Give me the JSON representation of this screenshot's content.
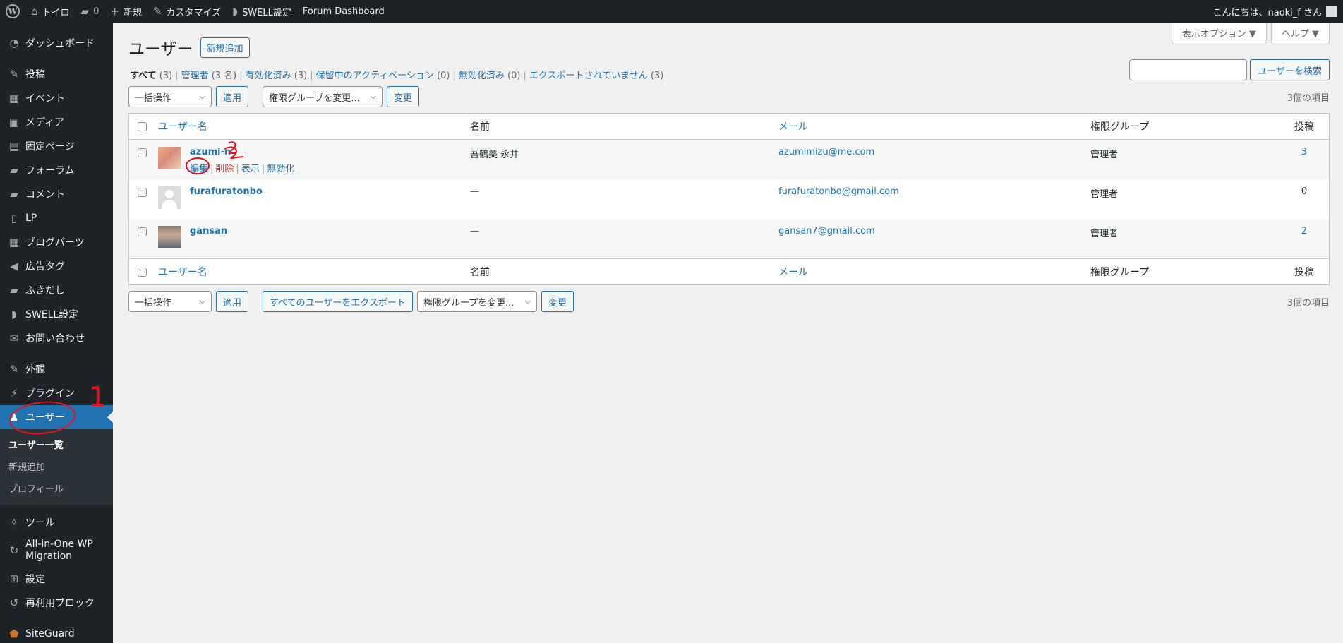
{
  "adminbar": {
    "site_name": "トイロ",
    "comments_count": "0",
    "new_label": "新規",
    "customize_label": "カスタマイズ",
    "swell_label": "SWELL設定",
    "forum_label": "Forum Dashboard",
    "greeting": "こんにちは、naoki_f さん"
  },
  "sidebar": {
    "items": [
      {
        "label": "ダッシュボード"
      },
      {
        "label": "投稿"
      },
      {
        "label": "イベント"
      },
      {
        "label": "メディア"
      },
      {
        "label": "固定ページ"
      },
      {
        "label": "フォーラム"
      },
      {
        "label": "コメント"
      },
      {
        "label": "LP"
      },
      {
        "label": "ブログパーツ"
      },
      {
        "label": "広告タグ"
      },
      {
        "label": "ふきだし"
      },
      {
        "label": "SWELL設定"
      },
      {
        "label": "お問い合わせ"
      },
      {
        "label": "外観"
      },
      {
        "label": "プラグイン"
      },
      {
        "label": "ユーザー"
      },
      {
        "label": "ツール"
      },
      {
        "label": "All-in-One WP Migration"
      },
      {
        "label": "設定"
      },
      {
        "label": "再利用ブロック"
      },
      {
        "label": "SiteGuard"
      }
    ],
    "submenu": [
      "ユーザー一覧",
      "新規追加",
      "プロフィール"
    ]
  },
  "screen_meta": {
    "options_label": "表示オプション ▼",
    "help_label": "ヘルプ ▼"
  },
  "page": {
    "title": "ユーザー",
    "add_new": "新規追加",
    "views": [
      {
        "label": "すべて",
        "count": "(3)"
      },
      {
        "label": "管理者",
        "count": "(3 名)"
      },
      {
        "label": "有効化済み",
        "count": "(3)"
      },
      {
        "label": "保留中のアクティベーション",
        "count": "(0)"
      },
      {
        "label": "無効化済み",
        "count": "(0)"
      },
      {
        "label": "エクスポートされていません",
        "count": "(3)"
      }
    ],
    "search_button": "ユーザーを検索",
    "search_value": ""
  },
  "tablenav_top": {
    "bulk_select": "一括操作",
    "apply": "適用",
    "role_select": "権限グループを変更...",
    "change": "変更",
    "count": "3個の項目"
  },
  "tablenav_bottom": {
    "bulk_select": "一括操作",
    "apply": "適用",
    "export_all": "すべてのユーザーをエクスポート",
    "role_select": "権限グループを変更...",
    "change": "変更",
    "count": "3個の項目"
  },
  "table": {
    "columns": {
      "username": "ユーザー名",
      "name": "名前",
      "email": "メール",
      "role": "権限グループ",
      "posts": "投稿"
    },
    "rows": [
      {
        "username": "azumi-n",
        "name": "吾鶴美 永井",
        "email": "azumimizu@me.com",
        "role": "管理者",
        "posts": "3"
      },
      {
        "username": "furafuratonbo",
        "name": "—",
        "email": "furafuratonbo@gmail.com",
        "role": "管理者",
        "posts": "0"
      },
      {
        "username": "gansan",
        "name": "—",
        "email": "gansan7@gmail.com",
        "role": "管理者",
        "posts": "2"
      }
    ],
    "row_actions": {
      "edit": "編集",
      "delete": "削除",
      "view": "表示",
      "deactivate": "無効化"
    }
  },
  "annotations": {
    "step1": "1",
    "step2": "2"
  },
  "colors": {
    "accent": "#2271b1",
    "adminbar": "#1d2327",
    "annotation": "#e0141e"
  }
}
